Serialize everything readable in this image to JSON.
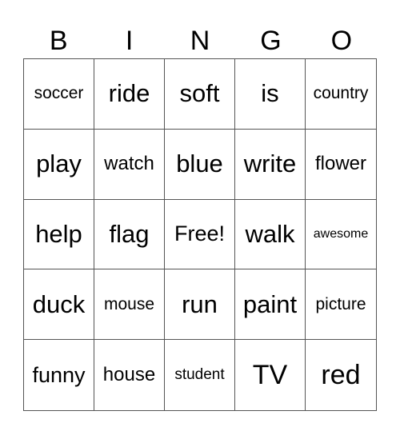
{
  "header": [
    "B",
    "I",
    "N",
    "G",
    "O"
  ],
  "cells": [
    {
      "text": "soccer",
      "size": "s-s"
    },
    {
      "text": "ride",
      "size": "s-l"
    },
    {
      "text": "soft",
      "size": "s-l"
    },
    {
      "text": "is",
      "size": "s-l"
    },
    {
      "text": "country",
      "size": "s-s"
    },
    {
      "text": "play",
      "size": "s-l"
    },
    {
      "text": "watch",
      "size": "s-sm"
    },
    {
      "text": "blue",
      "size": "s-l"
    },
    {
      "text": "write",
      "size": "s-l"
    },
    {
      "text": "flower",
      "size": "s-sm"
    },
    {
      "text": "help",
      "size": "s-l"
    },
    {
      "text": "flag",
      "size": "s-l"
    },
    {
      "text": "Free!",
      "size": "s-m"
    },
    {
      "text": "walk",
      "size": "s-l"
    },
    {
      "text": "awesome",
      "size": "s-xxs"
    },
    {
      "text": "duck",
      "size": "s-l"
    },
    {
      "text": "mouse",
      "size": "s-s"
    },
    {
      "text": "run",
      "size": "s-l"
    },
    {
      "text": "paint",
      "size": "s-l"
    },
    {
      "text": "picture",
      "size": "s-s"
    },
    {
      "text": "funny",
      "size": "s-m"
    },
    {
      "text": "house",
      "size": "s-sm"
    },
    {
      "text": "student",
      "size": "s-xs"
    },
    {
      "text": "TV",
      "size": "s-xl"
    },
    {
      "text": "red",
      "size": "s-xl"
    }
  ]
}
